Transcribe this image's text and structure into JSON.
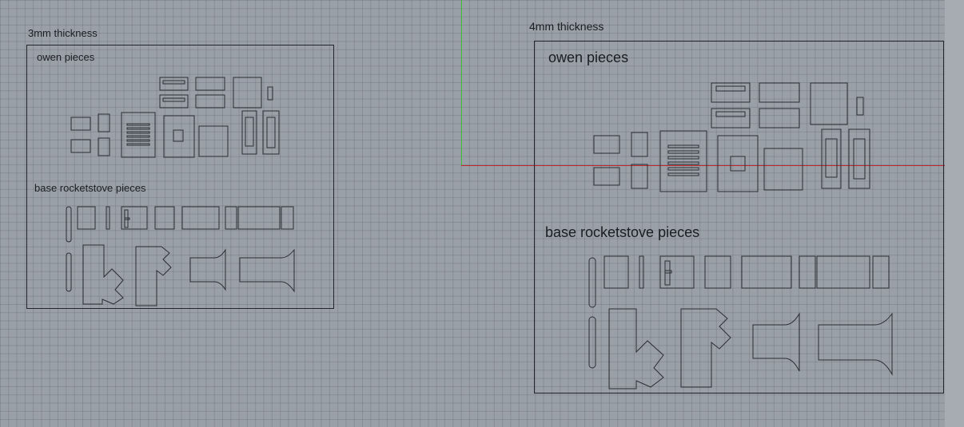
{
  "viewport": {
    "grid_color": "#9aa0a8",
    "x_axis_color": "#c0262b",
    "y_axis_color": "#3fc23a"
  },
  "panel_3mm": {
    "title": "3mm thickness",
    "section_owen": "owen pieces",
    "section_base": "base rocketstove pieces"
  },
  "panel_4mm": {
    "title": "4mm thickness",
    "section_owen": "owen pieces",
    "section_base": "base rocketstove pieces"
  }
}
